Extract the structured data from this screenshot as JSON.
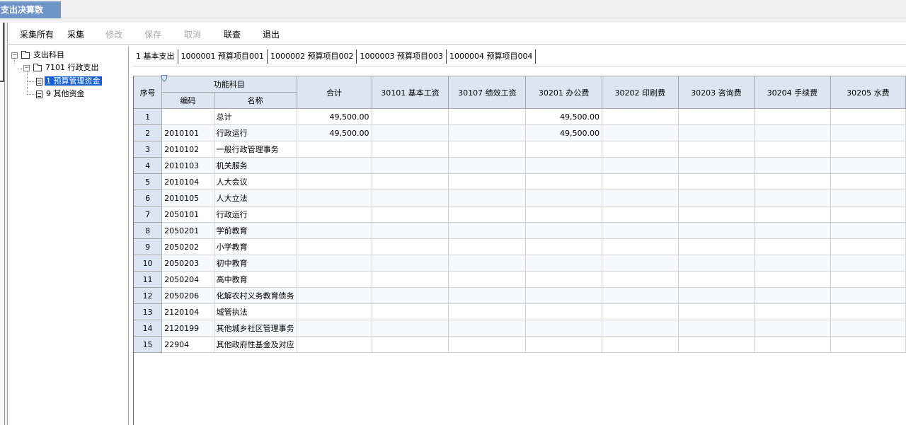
{
  "window": {
    "title": "支出决算数"
  },
  "toolbar": {
    "buttons": [
      {
        "label": "采集所有",
        "enabled": true
      },
      {
        "label": "采集",
        "enabled": true
      },
      {
        "label": "修改",
        "enabled": false
      },
      {
        "label": "保存",
        "enabled": false
      },
      {
        "label": "取消",
        "enabled": false
      },
      {
        "label": "联查",
        "enabled": true
      },
      {
        "label": "退出",
        "enabled": true
      }
    ]
  },
  "tree": {
    "root": "支出科目",
    "child": "7101 行政支出",
    "items": [
      {
        "label": "1 预算管理资金",
        "selected": true
      },
      {
        "label": "9 其他资金",
        "selected": false
      }
    ]
  },
  "tabs": [
    "1 基本支出",
    "1000001 预算项目001",
    "1000002 预算项目002",
    "1000003 预算项目003",
    "1000004 预算项目004"
  ],
  "grid": {
    "header": {
      "seq": "序号",
      "group": "功能科目",
      "code": "编码",
      "name": "名称",
      "total": "合计",
      "cols": [
        "30101 基本工资",
        "30107 绩效工资",
        "30201 办公费",
        "30202 印刷费",
        "30203 咨询费",
        "30204 手续费",
        "30205 水费"
      ]
    },
    "rows": [
      {
        "seq": "1",
        "code": "",
        "name": "总计",
        "total": "49,500.00",
        "c30201": "49,500.00"
      },
      {
        "seq": "2",
        "code": "2010101",
        "name": "行政运行",
        "total": "49,500.00",
        "c30201": "49,500.00"
      },
      {
        "seq": "3",
        "code": "2010102",
        "name": "一般行政管理事务",
        "total": "",
        "c30201": ""
      },
      {
        "seq": "4",
        "code": "2010103",
        "name": "机关服务",
        "total": "",
        "c30201": ""
      },
      {
        "seq": "5",
        "code": "2010104",
        "name": "人大会议",
        "total": "",
        "c30201": ""
      },
      {
        "seq": "6",
        "code": "2010105",
        "name": "人大立法",
        "total": "",
        "c30201": ""
      },
      {
        "seq": "7",
        "code": "2050101",
        "name": "行政运行",
        "total": "",
        "c30201": ""
      },
      {
        "seq": "8",
        "code": "2050201",
        "name": "学前教育",
        "total": "",
        "c30201": ""
      },
      {
        "seq": "9",
        "code": "2050202",
        "name": "小学教育",
        "total": "",
        "c30201": ""
      },
      {
        "seq": "10",
        "code": "2050203",
        "name": "初中教育",
        "total": "",
        "c30201": ""
      },
      {
        "seq": "11",
        "code": "2050204",
        "name": "高中教育",
        "total": "",
        "c30201": ""
      },
      {
        "seq": "12",
        "code": "2050206",
        "name": "化解农村义务教育债务",
        "total": "",
        "c30201": ""
      },
      {
        "seq": "13",
        "code": "2120104",
        "name": "城管执法",
        "total": "",
        "c30201": ""
      },
      {
        "seq": "14",
        "code": "2120199",
        "name": "其他城乡社区管理事务",
        "total": "",
        "c30201": ""
      },
      {
        "seq": "15",
        "code": "22904",
        "name": "其他政府性基金及对应",
        "total": "",
        "c30201": ""
      }
    ]
  },
  "colors": {
    "title_tab": "#6f94c8",
    "header_bg": "#dce6f2",
    "selected": "#1460d4"
  }
}
